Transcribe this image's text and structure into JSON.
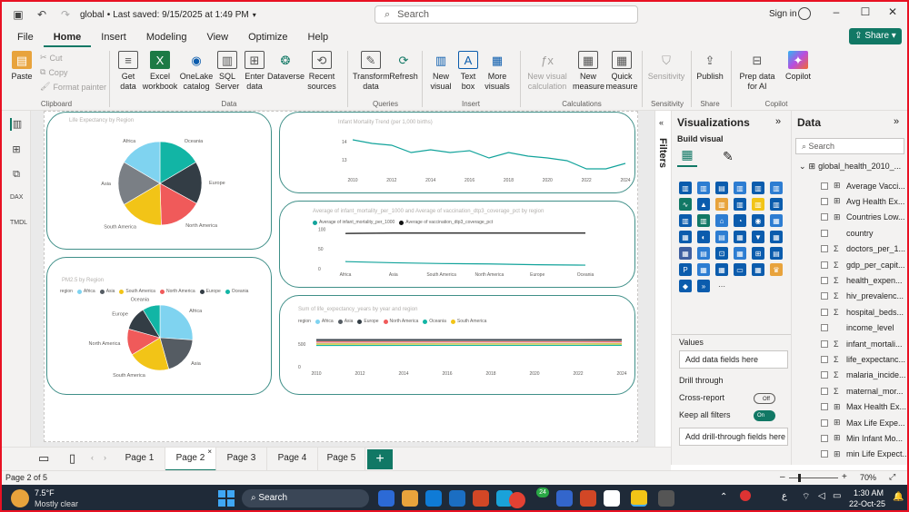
{
  "titlebar": {
    "file_name": "global",
    "saved_text": "Last saved: 9/15/2025 at 1:49 PM",
    "search_placeholder": "Search",
    "signin": "Sign in"
  },
  "menu": {
    "items": [
      "File",
      "Home",
      "Insert",
      "Modeling",
      "View",
      "Optimize",
      "Help"
    ],
    "active": "Home",
    "share": "Share"
  },
  "ribbon": {
    "clipboard": {
      "paste": "Paste",
      "cut": "Cut",
      "copy": "Copy",
      "format_painter": "Format painter",
      "group": "Clipboard"
    },
    "data": {
      "get_data": "Get data",
      "excel": "Excel workbook",
      "onelake": "OneLake catalog",
      "sql": "SQL Server",
      "enter": "Enter data",
      "dataverse": "Dataverse",
      "recent": "Recent sources",
      "group": "Data"
    },
    "queries": {
      "transform": "Transform data",
      "refresh": "Refresh",
      "group": "Queries"
    },
    "insert": {
      "new_visual": "New visual",
      "text_box": "Text box",
      "more_visuals": "More visuals",
      "group": "Insert"
    },
    "calculations": {
      "new_visual_calc": "New visual calculation",
      "new_measure": "New measure",
      "quick_measure": "Quick measure",
      "group": "Calculations"
    },
    "sensitivity": {
      "label": "Sensitivity",
      "group": "Sensitivity"
    },
    "share": {
      "publish": "Publish",
      "group": "Share"
    },
    "copilot": {
      "prep": "Prep data for AI",
      "copilot": "Copilot",
      "group": "Copilot"
    }
  },
  "visuals": {
    "pie1": {
      "title": "Life Expectancy by Region",
      "chart_data": {
        "type": "pie",
        "title": "Life Expectancy by Region",
        "categories": [
          "Oceania",
          "Europe",
          "North America",
          "South America",
          "Asia",
          "Africa"
        ],
        "values": [
          16.5,
          16.5,
          16.5,
          17,
          17,
          16.5
        ],
        "colors": [
          "#12b5a5",
          "#333d45",
          "#f05a5a",
          "#f2c417",
          "#7a7f85",
          "#7fd3f0"
        ],
        "labels": {
          "oceania": "Oceania",
          "europe": "Europe",
          "north_america": "North America",
          "south_america": "South America",
          "asia": "Asia",
          "africa": "Africa"
        }
      }
    },
    "pie2": {
      "title": "PM2.5 by Region",
      "legend_title": "region",
      "chart_data": {
        "type": "pie",
        "title": "PM2.5 by Region",
        "categories": [
          "Africa",
          "Asia",
          "South America",
          "North America",
          "Europe",
          "Oceania"
        ],
        "values": [
          24,
          18,
          19,
          12,
          11,
          8
        ],
        "colors": [
          "#7fd3f0",
          "#555c63",
          "#f2c417",
          "#f05a5a",
          "#333d45",
          "#12b5a5"
        ],
        "labels": {
          "africa": "Africa",
          "asia": "Asia",
          "south_america": "South America",
          "north_america": "North America",
          "europe": "Europe",
          "oceania": "Oceania"
        }
      }
    },
    "line1": {
      "title": "Infant Mortality Trend (per 1,000 births)",
      "chart_data": {
        "type": "line",
        "x": [
          2010,
          2011,
          2012,
          2013,
          2014,
          2015,
          2016,
          2017,
          2018,
          2019,
          2020,
          2021,
          2022,
          2023,
          2024
        ],
        "values": [
          14.1,
          13.9,
          13.8,
          13.4,
          13.55,
          13.4,
          13.5,
          13.1,
          13.4,
          13.2,
          13.1,
          12.95,
          12.5,
          12.5,
          12.8
        ],
        "color": "#12a39b",
        "ylim": [
          12.5,
          14.5
        ],
        "yticks": [
          13,
          14
        ],
        "xticks": [
          "2010",
          "2012",
          "2014",
          "2016",
          "2018",
          "2020",
          "2022",
          "2024"
        ]
      }
    },
    "line2": {
      "title": "Average of infant_mortality_per_1000 and Average of vaccination_dtp3_coverage_pct by region",
      "legend": [
        "Average of infant_mortality_per_1000",
        "Average of vaccination_dtp3_coverage_pct"
      ],
      "chart_data": {
        "type": "line",
        "categories": [
          "Africa",
          "Asia",
          "South America",
          "North America",
          "Europe",
          "Oceania"
        ],
        "series": [
          {
            "name": "Average of vaccination_dtp3_coverage_pct",
            "values": [
              89,
              90,
              90,
              90,
              90,
              90
            ],
            "color": "#111111"
          },
          {
            "name": "Average of infant_mortality_per_1000",
            "values": [
              18,
              15,
              13,
              12,
              10,
              9
            ],
            "color": "#12a39b"
          }
        ],
        "ylim": [
          0,
          110
        ],
        "yticks": [
          0,
          50,
          100
        ]
      }
    },
    "line3": {
      "title": "Sum of life_expectancy_years by year and region",
      "legend_title": "region",
      "chart_data": {
        "type": "line",
        "x": [
          2010,
          2024
        ],
        "xticks": [
          "2010",
          "2012",
          "2014",
          "2016",
          "2018",
          "2020",
          "2022",
          "2024"
        ],
        "yticks": [
          0,
          500
        ],
        "ylim": [
          0,
          800
        ],
        "series": [
          {
            "name": "Africa",
            "values": [
              510,
              510
            ],
            "color": "#7fd3f0"
          },
          {
            "name": "Asia",
            "values": [
              600,
              602
            ],
            "color": "#555c63"
          },
          {
            "name": "Europe",
            "values": [
              580,
              582
            ],
            "color": "#333d45"
          },
          {
            "name": "North America",
            "values": [
              545,
              547
            ],
            "color": "#f05a5a"
          },
          {
            "name": "Oceania",
            "values": [
              470,
              472
            ],
            "color": "#12b5a5"
          },
          {
            "name": "South America",
            "values": [
              500,
              502
            ],
            "color": "#f2c417"
          }
        ]
      }
    }
  },
  "filters_label": "Filters",
  "viz_pane": {
    "title": "Visualizations",
    "build_visual": "Build visual",
    "values_label": "Values",
    "values_placeholder": "Add data fields here",
    "drill_through": "Drill through",
    "cross_report": "Cross-report",
    "cross_state": "Off",
    "keep_filters": "Keep all filters",
    "keep_state": "On",
    "drill_placeholder": "Add drill-through fields here"
  },
  "data_pane": {
    "title": "Data",
    "search": "Search",
    "table": "global_health_2010_...",
    "fields": [
      {
        "icon": "table",
        "name": "Average Vacci..."
      },
      {
        "icon": "table",
        "name": "Avg Health Ex..."
      },
      {
        "icon": "table",
        "name": "Countries Low..."
      },
      {
        "icon": "",
        "name": "country"
      },
      {
        "icon": "sigma",
        "name": "doctors_per_1..."
      },
      {
        "icon": "sigma",
        "name": "gdp_per_capit..."
      },
      {
        "icon": "sigma",
        "name": "health_expen..."
      },
      {
        "icon": "sigma",
        "name": "hiv_prevalenc..."
      },
      {
        "icon": "sigma",
        "name": "hospital_beds..."
      },
      {
        "icon": "",
        "name": "income_level"
      },
      {
        "icon": "sigma",
        "name": "infant_mortali..."
      },
      {
        "icon": "sigma",
        "name": "life_expectanc..."
      },
      {
        "icon": "sigma",
        "name": "malaria_incide..."
      },
      {
        "icon": "sigma",
        "name": "maternal_mor..."
      },
      {
        "icon": "table",
        "name": "Max Health Ex..."
      },
      {
        "icon": "table",
        "name": "Max Life Expe..."
      },
      {
        "icon": "table",
        "name": "Min Infant Mo..."
      },
      {
        "icon": "table",
        "name": "min Life Expect..."
      }
    ]
  },
  "pages": {
    "tabs": [
      "Page 1",
      "Page 2",
      "Page 3",
      "Page 4",
      "Page 5"
    ],
    "active": "Page 2",
    "add": "+"
  },
  "status": {
    "page_of": "Page 2 of 5",
    "zoom": "70%"
  },
  "taskbar": {
    "temp": "7.5°F",
    "weather": "Mostly clear",
    "search": "Search",
    "time": "1:30 AM",
    "date": "22-Oct-25",
    "badge": "24",
    "lang": "ع"
  }
}
